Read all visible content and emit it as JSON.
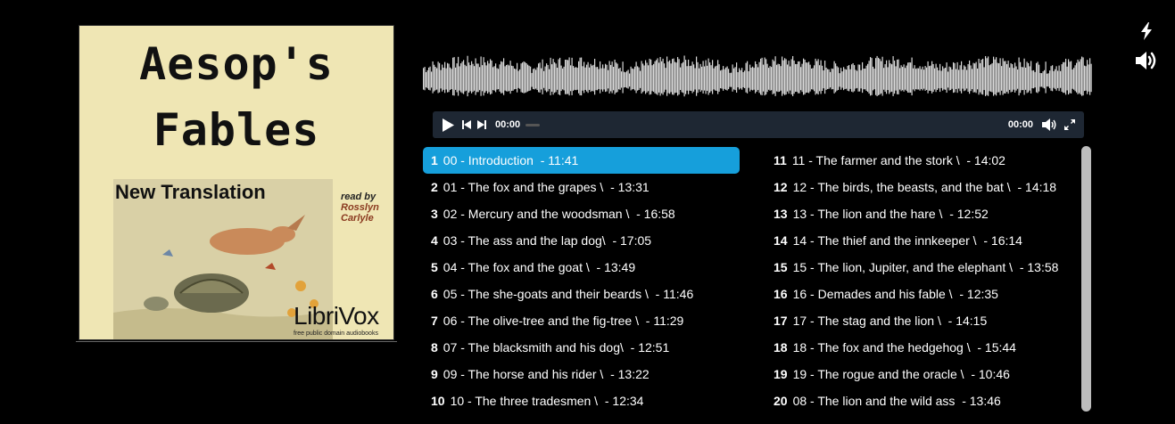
{
  "cover": {
    "title_line1": "Aesop's",
    "title_line2": "Fables",
    "subtitle": "New Translation",
    "reader_prefix": "read by",
    "reader_name1": "Rosslyn",
    "reader_name2": "Carlyle",
    "publisher": "LibriVox",
    "publisher_tagline": "free public domain audiobooks"
  },
  "player": {
    "current_time": "00:00",
    "duration": "00:00",
    "progress": 0
  },
  "icons": {
    "top_right": [
      "lightning-icon",
      "speaker-icon"
    ],
    "controls": [
      "play-icon",
      "previous-icon",
      "next-icon",
      "volume-icon",
      "fullscreen-icon"
    ]
  },
  "colors": {
    "background": "#000000",
    "active_track": "#169fdb",
    "player_bar": "#1e2733",
    "waveform": "#d9d9d9"
  },
  "playlist": {
    "active_index": 0,
    "tracks": [
      {
        "num": "1",
        "title": "00 - Introduction  - 11:41"
      },
      {
        "num": "2",
        "title": "01 - The fox and the grapes \\  - 13:31"
      },
      {
        "num": "3",
        "title": "02 - Mercury and the woodsman \\  - 16:58"
      },
      {
        "num": "4",
        "title": "03 - The ass and the lap dog\\  - 17:05"
      },
      {
        "num": "5",
        "title": "04 - The fox and the goat \\  - 13:49"
      },
      {
        "num": "6",
        "title": "05 - The she-goats and their beards \\  - 11:46"
      },
      {
        "num": "7",
        "title": "06 - The olive-tree and the fig-tree \\  - 11:29"
      },
      {
        "num": "8",
        "title": "07 - The blacksmith and his dog\\  - 12:51"
      },
      {
        "num": "9",
        "title": "09 - The horse and his rider \\  - 13:22"
      },
      {
        "num": "10",
        "title": "10 - The three tradesmen \\  - 12:34"
      },
      {
        "num": "11",
        "title": "11 - The farmer and the stork \\  - 14:02"
      },
      {
        "num": "12",
        "title": "12 - The birds, the beasts, and the bat \\  - 14:18"
      },
      {
        "num": "13",
        "title": "13 - The lion and the hare \\  - 12:52"
      },
      {
        "num": "14",
        "title": "14 - The thief and the innkeeper \\  - 16:14"
      },
      {
        "num": "15",
        "title": "15 - The lion, Jupiter, and the elephant \\  - 13:58"
      },
      {
        "num": "16",
        "title": "16 - Demades and his fable \\  - 12:35"
      },
      {
        "num": "17",
        "title": "17 - The stag and the lion \\  - 14:15"
      },
      {
        "num": "18",
        "title": "18 - The fox and the hedgehog \\  - 15:44"
      },
      {
        "num": "19",
        "title": "19 - The rogue and the oracle \\  - 10:46"
      },
      {
        "num": "20",
        "title": "08 - The lion and the wild ass  - 13:46"
      }
    ]
  }
}
